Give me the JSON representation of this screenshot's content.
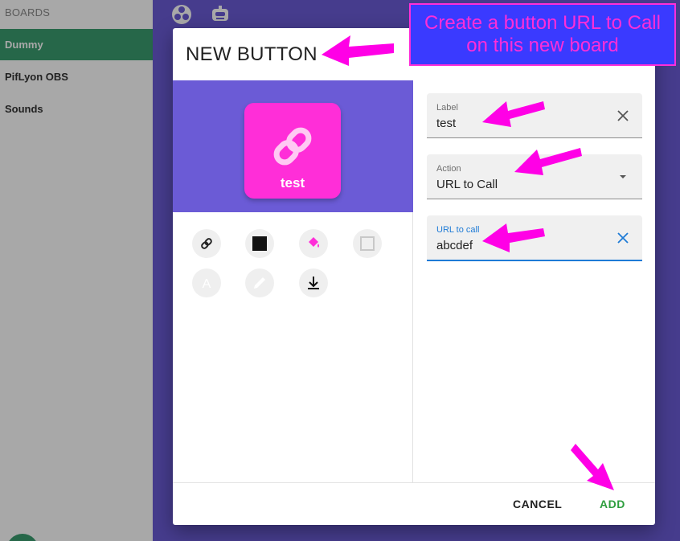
{
  "sidebar": {
    "header": "BOARDS",
    "items": [
      {
        "label": "Dummy",
        "active": true
      },
      {
        "label": "PifLyon OBS",
        "active": false
      },
      {
        "label": "Sounds",
        "active": false
      }
    ]
  },
  "topbar": {
    "icons": [
      "obs-icon",
      "robot-icon"
    ]
  },
  "dialog": {
    "title": "NEW BUTTON",
    "preview": {
      "label": "test",
      "icon": "link-icon",
      "color": "#ff2ed8"
    },
    "tools": [
      "link-icon",
      "square-icon",
      "paint-bucket-icon",
      "outline-square-icon",
      "text-icon",
      "pencil-icon",
      "download-icon"
    ],
    "fields": {
      "label": {
        "label": "Label",
        "value": "test"
      },
      "action": {
        "label": "Action",
        "value": "URL to Call"
      },
      "url": {
        "label": "URL to call",
        "value": "abcdef"
      }
    },
    "buttons": {
      "cancel": "CANCEL",
      "add": "ADD"
    }
  },
  "annotation": {
    "text": "Create a button URL to Call on this new board"
  },
  "colors": {
    "accent": "#6b5bd6",
    "primary": "#3a9d6f",
    "highlight": "#ff2ed8",
    "focus": "#1e7bd6"
  }
}
